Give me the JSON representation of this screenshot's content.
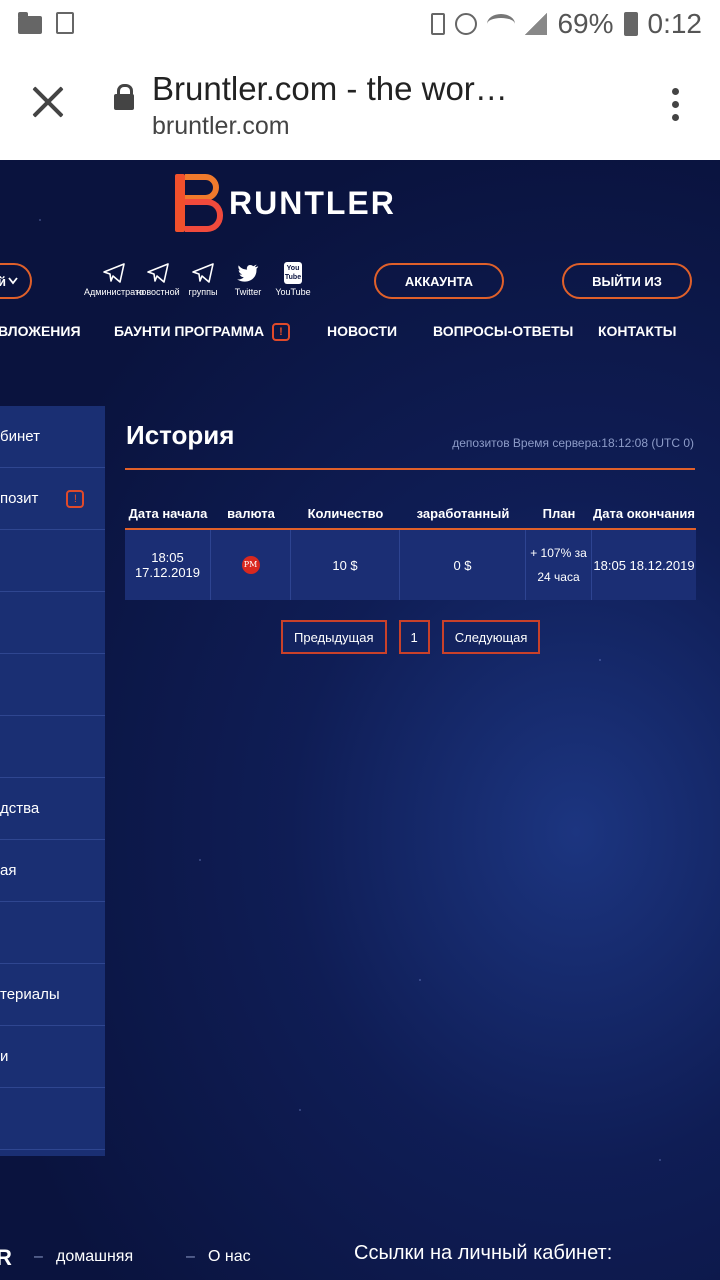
{
  "status_bar": {
    "battery_percent": "69%",
    "time": "0:12",
    "icons": [
      "folder-icon",
      "clipboard-icon",
      "battery-saver-icon",
      "alarm-icon",
      "wifi-icon",
      "signal-icon",
      "battery-icon"
    ]
  },
  "browser": {
    "tab_title": "Bruntler.com - the wor…",
    "domain": "bruntler.com"
  },
  "site": {
    "logo_text": "RUNTLER",
    "left_pill_partial": "й",
    "social": [
      {
        "label": "Администрато",
        "icon": "telegram-icon"
      },
      {
        "label": "новостной",
        "icon": "telegram-icon"
      },
      {
        "label": "группы",
        "icon": "telegram-icon"
      },
      {
        "label": "Twitter",
        "icon": "twitter-icon"
      },
      {
        "label": "YouTube",
        "icon": "youtube-icon"
      }
    ],
    "youtube_glyph": "You\nTube",
    "account_button": "АККАУНТА",
    "logout_button": "ВЫЙТИ ИЗ",
    "nav": [
      {
        "label": "ВЛОЖЕНИЯ"
      },
      {
        "label": "БАУНТИ ПРОГРАММА"
      },
      {
        "label": "НОВОСТИ"
      },
      {
        "label": "ВОПРОСЫ-ОТВЕТЫ"
      },
      {
        "label": "КОНТАКТЫ"
      }
    ],
    "sidebar": [
      {
        "label": "бинет"
      },
      {
        "label": "позит"
      },
      {
        "label": ""
      },
      {
        "label": ""
      },
      {
        "label": ""
      },
      {
        "label": ""
      },
      {
        "label": "дства"
      },
      {
        "label": "ая"
      },
      {
        "label": ""
      },
      {
        "label": "териалы"
      },
      {
        "label": "и"
      },
      {
        "label": ""
      }
    ],
    "page_title": "История",
    "server_time_text": "депозитов Время сервера:18:12:08 (UTC 0)",
    "table": {
      "headers": [
        "Дата начала",
        "валюта",
        "Количество",
        "заработанный",
        "План",
        "Дата окончания"
      ],
      "rows": [
        {
          "start": "18:05 17.12.2019",
          "currency_badge": "PM",
          "amount": "10 $",
          "earned": "0 $",
          "plan_line1": "+ 107% за",
          "plan_line2": "24 часа",
          "end": "18:05 18.12.2019"
        }
      ]
    },
    "pagination": {
      "prev": "Предыдущая",
      "current": "1",
      "next": "Следующая"
    },
    "footer": {
      "logo_partial": "R",
      "link_home": "домашняя",
      "link_about": "О нас",
      "cabinet_links_title": "Ссылки на личный кабинет:"
    }
  }
}
